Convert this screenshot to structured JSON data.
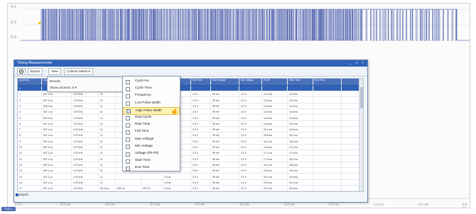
{
  "scope": {
    "y_labels": [
      "4.0",
      "2.0",
      "0.0"
    ],
    "x_labels": [
      "1.5 s",
      "-4.5 ms",
      "-4.0 ms",
      "-3.5 ms",
      "-3.0 ms",
      "-2.5 ms",
      "-2.0 ms",
      "-1.5 ms",
      "-1.0 ms",
      "-0.5 ms",
      "0.0 ms"
    ],
    "time_box": "0.00 s",
    "trace_color": "#3b4fa6"
  },
  "window": {
    "title": "Timing Measurements",
    "controls": "_ □ ×",
    "toolbar": {
      "settings_icon": "gear-icon",
      "export_label": "Export",
      "view_label": "View",
      "columns_label": "Column Select",
      "columns_caret": "▾"
    },
    "status_label": "Export"
  },
  "dropdown": {
    "line1": "Results",
    "line2": "Show columns:  5 ▾"
  },
  "column_menu": [
    {
      "label": "Cycle No.",
      "checked": false,
      "highlight": false
    },
    {
      "label": "Cycle Time",
      "checked": false,
      "highlight": false
    },
    {
      "label": "Frequency",
      "checked": false,
      "highlight": false
    },
    {
      "label": "Low Pulse Width",
      "checked": false,
      "highlight": false
    },
    {
      "label": "High Pulse Width",
      "checked": true,
      "highlight": true
    },
    {
      "label": "Duty Cycle",
      "checked": false,
      "highlight": false
    },
    {
      "label": "Rise Time",
      "checked": false,
      "highlight": false
    },
    {
      "label": "Fall Time",
      "checked": false,
      "highlight": false
    },
    {
      "label": "Max Voltage",
      "checked": false,
      "highlight": false
    },
    {
      "label": "Min Voltage",
      "checked": false,
      "highlight": false
    },
    {
      "label": "Voltage (Pk-Pk)",
      "checked": false,
      "highlight": false
    },
    {
      "label": "Start Time",
      "checked": false,
      "highlight": false
    },
    {
      "label": "End Time",
      "checked": false,
      "highlight": false
    }
  ],
  "table": {
    "headers": [
      "Cycle No.",
      "Cycle Time",
      "Frequency",
      "Low Pulse",
      "High Pulse",
      "Duty Cycle",
      "Rise Time",
      "Fall Time",
      "Max Voltage",
      "Min Voltage",
      "Pk-Pk",
      "Start Time",
      "End Time"
    ],
    "rows": [
      [
        "0",
        "",
        "",
        "",
        "",
        "",
        "",
        "",
        "",
        "",
        "",
        "",
        ""
      ],
      [
        "1",
        "507.1 us",
        "1.97 kHz",
        "11",
        "",
        "",
        "4.0 ns",
        "3.3 V",
        "95 mV",
        "3.2 V",
        "12.0 ms",
        "12.5 ms",
        ""
      ],
      [
        "2",
        "507.1 us",
        "1.97 kHz",
        "11",
        "",
        "",
        "4.0 ns",
        "3.3 V",
        "95 mV",
        "3.2 V",
        "12.5 ms",
        "13.0 ms",
        ""
      ],
      [
        "3",
        "520.0 us",
        "1.92 kHz",
        "11",
        "",
        "",
        "4.0 ns",
        "3.3 V",
        "95 mV",
        "3.2 V",
        "13.0 ms",
        "13.5 ms",
        ""
      ],
      [
        "4",
        "507.1 us",
        "1.97 kHz",
        "11",
        "",
        "",
        "4.0 ns",
        "3.3 V",
        "95 mV",
        "3.2 V",
        "13.5 ms",
        "14.0 ms",
        ""
      ],
      [
        "5",
        "507.0 us",
        "1.97 kHz",
        "11",
        "",
        "",
        "4.0 ns",
        "3.3 V",
        "95 mV",
        "3.2 V",
        "14.0 ms",
        "14.6 ms",
        ""
      ],
      [
        "6",
        "507.1 us",
        "1.97 kHz",
        "11",
        "",
        "",
        "4.0 ns",
        "3.3 V",
        "95 mV",
        "3.2 V",
        "14.6 ms",
        "15.1 ms",
        ""
      ],
      [
        "7",
        "507.1 us",
        "1.97 kHz",
        "11",
        "",
        "",
        "4.0 ns",
        "3.3 V",
        "95 mV",
        "3.2 V",
        "15.1 ms",
        "15.6 ms",
        ""
      ],
      [
        "8",
        "507.1 us",
        "1.97 kHz",
        "11",
        "",
        "",
        "4.0 ns",
        "3.3 V",
        "95 mV",
        "3.2 V",
        "15.6 ms",
        "16.1 ms",
        ""
      ],
      [
        "9",
        "507.1 us",
        "1.97 kHz",
        "11",
        "",
        "",
        "4.0 ns",
        "3.3 V",
        "95 mV",
        "3.2 V",
        "16.1 ms",
        "16.6 ms",
        ""
      ],
      [
        "10",
        "507.1 us",
        "1.97 kHz",
        "11",
        "",
        "",
        "4.0 ns",
        "3.3 V",
        "95 mV",
        "3.2 V",
        "16.6 ms",
        "17.1 ms",
        ""
      ],
      [
        "11",
        "507.1 us",
        "1.97 kHz",
        "11",
        "",
        "",
        "4.0 ns",
        "3.3 V",
        "95 mV",
        "3.2 V",
        "17.1 ms",
        "17.6 ms",
        ""
      ],
      [
        "12",
        "507.1 us",
        "1.97 kHz",
        "11",
        "",
        "",
        "4.0 ns",
        "3.3 V",
        "95 mV",
        "3.2 V",
        "17.6 ms",
        "18.1 ms",
        ""
      ],
      [
        "13",
        "507.1 us",
        "1.97 kHz",
        "11",
        "",
        "",
        "4.0 ns",
        "3.3 V",
        "95 mV",
        "3.2 V",
        "18.1 ms",
        "18.6 ms",
        ""
      ],
      [
        "14",
        "507.1 us",
        "1.97 kHz",
        "11",
        "",
        "",
        "4.0 ns",
        "3.3 V",
        "95 mV",
        "3.2 V",
        "18.6 ms",
        "19.1 ms",
        ""
      ],
      [
        "15",
        "507.1 us",
        "1.97 kHz",
        "11",
        "",
        "",
        "4.0 ns",
        "3.3 V",
        "95 mV",
        "3.2 V",
        "19.1 ms",
        "19.6 ms",
        ""
      ],
      [
        "16",
        "507.1 us",
        "1.97 kHz",
        "11",
        "",
        "",
        "4.0 ns",
        "3.3 V",
        "95 mV",
        "3.2 V",
        "19.6 ms",
        "20.1 ms",
        ""
      ],
      [
        "17",
        "507.1 us",
        "1.97 kHz",
        "50.0 ms",
        "250 us",
        "49.2 %",
        "4.0 ns",
        "3.3 V",
        "95 mV",
        "3.2 V",
        "20.1 ms",
        "20.6 ms",
        ""
      ]
    ]
  }
}
